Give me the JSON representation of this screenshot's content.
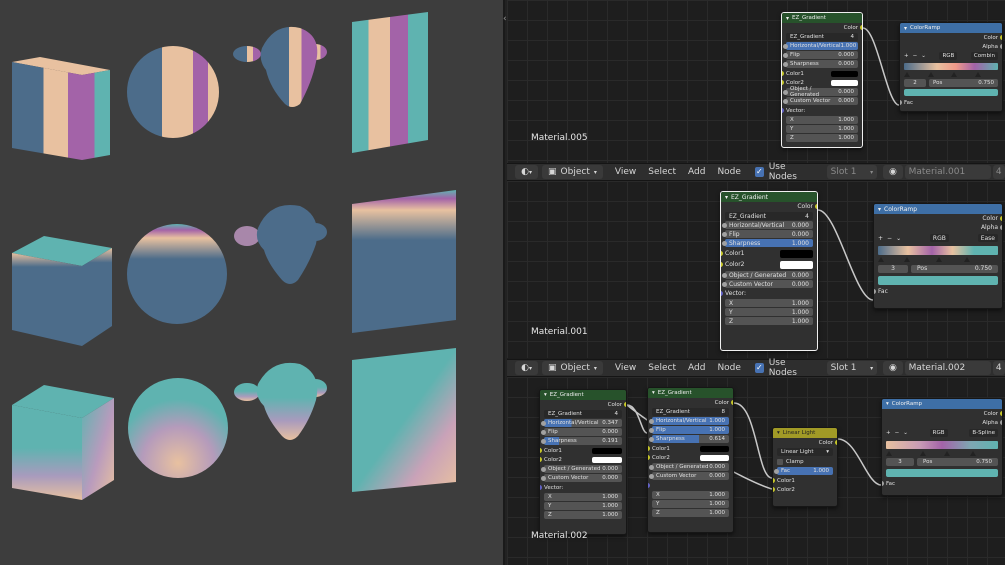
{
  "colors": {
    "teal": "#5fb3b0",
    "peach": "#e8c1a0",
    "purple": "#a363a8",
    "slate": "#4c6c8a",
    "node_green": "#27522b",
    "node_blue": "#3e6fa6",
    "node_yellow": "#a19a26",
    "accent": "#4772b3"
  },
  "header": {
    "object_mode": "Object",
    "menus": [
      "View",
      "Select",
      "Add",
      "Node"
    ],
    "use_nodes": "Use Nodes",
    "bar1": {
      "slot": "Slot 1",
      "material": "Material.001",
      "users": "4"
    },
    "bar2": {
      "slot": "Slot 1",
      "material": "Material.002",
      "users": "4"
    }
  },
  "editor1": {
    "material_label": "Material.005",
    "ez": {
      "title": "EZ_Gradient",
      "out_color": "Color",
      "group_name": "EZ_Gradient",
      "users": "4",
      "hv_label": "Horizontal/Vertical",
      "hv_value": "1.000",
      "flip_label": "Flip",
      "flip_value": "0.000",
      "sharp_label": "Sharpness",
      "sharp_value": "0.000",
      "color1": "Color1",
      "color2": "Color2",
      "obj_label": "Object / Generated",
      "obj_value": "0.000",
      "cv_label": "Custom Vector",
      "cv_value": "0.000",
      "vector": "Vector:",
      "x": "X",
      "xv": "1.000",
      "y": "Y",
      "yv": "1.000",
      "z": "Z",
      "zv": "1.000"
    },
    "ramp": {
      "title": "ColorRamp",
      "out_color": "Color",
      "out_alpha": "Alpha",
      "mode": "RGB",
      "interp": "Combin",
      "index": "2",
      "pos_label": "Pos",
      "pos_value": "0.750",
      "fac": "Fac",
      "plus": "+",
      "minus": "−",
      "menu": "⌄"
    }
  },
  "editor2": {
    "material_label": "Material.001",
    "ez": {
      "title": "EZ_Gradient",
      "out_color": "Color",
      "group_name": "EZ_Gradient",
      "users": "4",
      "hv_label": "Horizontal/Vertical",
      "hv_value": "0.000",
      "flip_label": "Flip",
      "flip_value": "0.000",
      "sharp_label": "Sharpness",
      "sharp_value": "1.000",
      "color1": "Color1",
      "color2": "Color2",
      "obj_label": "Object / Generated",
      "obj_value": "0.000",
      "cv_label": "Custom Vector",
      "cv_value": "0.000",
      "vector": "Vector:",
      "x": "X",
      "xv": "1.000",
      "y": "Y",
      "yv": "1.000",
      "z": "Z",
      "zv": "1.000"
    },
    "ramp": {
      "title": "ColorRamp",
      "out_color": "Color",
      "out_alpha": "Alpha",
      "mode": "RGB",
      "interp": "Ease",
      "index": "3",
      "pos_label": "Pos",
      "pos_value": "0.750",
      "fac": "Fac",
      "plus": "+",
      "minus": "−",
      "menu": "⌄"
    }
  },
  "editor3": {
    "material_label": "Material.002",
    "ez_a": {
      "title": "EZ_Gradient",
      "out_color": "Color",
      "group_name": "EZ_Gradient",
      "users": "4",
      "hv_label": "Horizontal/Vertical",
      "hv_value": "0.347",
      "flip_label": "Flip",
      "flip_value": "0.000",
      "sharp_label": "Sharpness",
      "sharp_value": "0.191",
      "color1": "Color1",
      "color2": "Color2",
      "obj_label": "Object / Generated",
      "obj_value": "0.000",
      "cv_label": "Custom Vector",
      "cv_value": "0.000",
      "vector": "Vector:",
      "x": "X",
      "xv": "1.000",
      "y": "Y",
      "yv": "1.000",
      "z": "Z",
      "zv": "1.000"
    },
    "ez_b": {
      "title": "EZ_Gradient",
      "out_color": "Color",
      "group_name": "EZ_Gradient",
      "users": "8",
      "hv_label": "Horizontal/Vertical",
      "hv_value": "1.000",
      "flip_label": "Flip",
      "flip_value": "1.000",
      "sharp_label": "Sharpness",
      "sharp_value": "0.614",
      "color1": "Color1",
      "color2": "Color2",
      "obj_label": "Object / Generated",
      "obj_value": "0.000",
      "cv_label": "Custom Vector",
      "cv_value": "0.000",
      "vector": "Vector:",
      "x": "X",
      "xv": "1.000",
      "y": "Y",
      "yv": "1.000",
      "z": "Z",
      "zv": "1.000"
    },
    "mix": {
      "title": "Linear Light",
      "out_color": "Color",
      "blend": "Linear Light",
      "clamp": "Clamp",
      "fac_label": "Fac",
      "fac_value": "1.000",
      "color1": "Color1",
      "color2": "Color2"
    },
    "ramp": {
      "title": "ColorRamp",
      "out_color": "Color",
      "out_alpha": "Alpha",
      "mode": "RGB",
      "interp": "B-Spline",
      "index": "3",
      "pos_label": "Pos",
      "pos_value": "0.750",
      "fac": "Fac",
      "plus": "+",
      "minus": "−",
      "menu": "⌄"
    }
  }
}
